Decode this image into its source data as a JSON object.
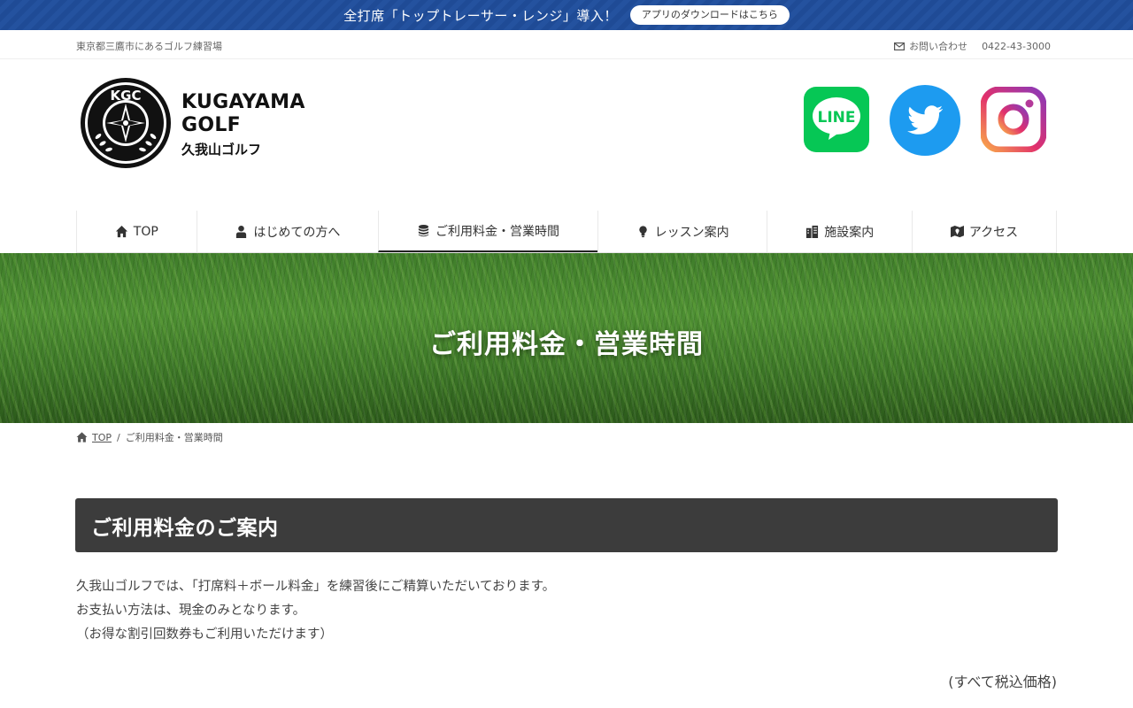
{
  "announcement": {
    "text": "全打席「トップトレーサー・レンジ」導入！",
    "button_label": "アプリのダウンロードはこちら"
  },
  "utility": {
    "tagline": "東京都三鷹市にあるゴルフ練習場",
    "contact_label": "お問い合わせ",
    "phone": "0422-43-3000"
  },
  "logo": {
    "line1": "KUGAYAMA",
    "line2": "GOLF",
    "japanese": "久我山ゴルフ",
    "emblem_letters": "KGC"
  },
  "social": {
    "line_label": "LINE",
    "colors": {
      "line": "#06c755",
      "twitter": "#1d9bf0",
      "instagram_start": "#f9a94a",
      "instagram_end": "#8a3ab9"
    }
  },
  "nav": {
    "items": [
      {
        "label": "TOP",
        "icon": "home-icon"
      },
      {
        "label": "はじめての方へ",
        "icon": "user-icon"
      },
      {
        "label": "ご利用料金・営業時間",
        "icon": "coins-icon",
        "active": true
      },
      {
        "label": "レッスン案内",
        "icon": "lightbulb-icon"
      },
      {
        "label": "施設案内",
        "icon": "building-icon"
      },
      {
        "label": "アクセス",
        "icon": "map-icon"
      }
    ]
  },
  "hero": {
    "title": "ご利用料金・営業時間"
  },
  "breadcrumb": {
    "home": "TOP",
    "separator": "/",
    "current": "ご利用料金・営業時間"
  },
  "section": {
    "title": "ご利用料金のご案内",
    "paragraph_lines": [
      "久我山ゴルフでは、「打席料＋ボール料金」を練習後にご精算いただいております。",
      "お支払い方法は、現金のみとなります。",
      "（お得な割引回数券もご利用いただけます）"
    ],
    "tax_note": "(すべて税込価格)"
  }
}
